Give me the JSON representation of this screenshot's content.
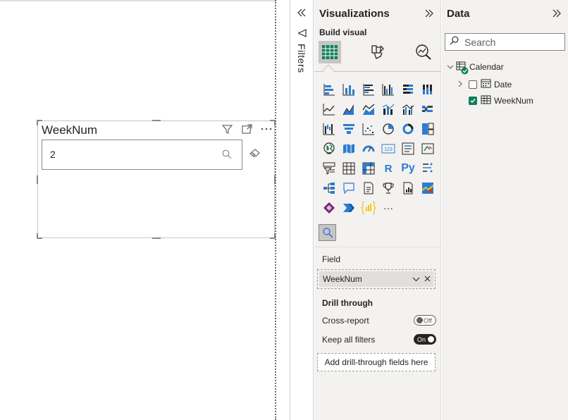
{
  "canvas": {
    "visual": {
      "title": "WeekNum",
      "search_value": "2",
      "header_icons": [
        "filter-icon",
        "focus-mode-icon",
        "more-options-icon"
      ]
    }
  },
  "filters_pane": {
    "label": "Filters"
  },
  "visualizations": {
    "title": "Visualizations",
    "build_label": "Build visual",
    "tabs": [
      "build-visual-tab",
      "format-visual-tab",
      "analytics-tab"
    ],
    "r_label": "R",
    "py_label": "Py",
    "more_label": "···",
    "field_section": "Field",
    "field_value": "WeekNum",
    "drill_title": "Drill through",
    "cross_report_label": "Cross-report",
    "cross_report_state": "Off",
    "keep_filters_label": "Keep all filters",
    "keep_filters_state": "On",
    "drill_placeholder": "Add drill-through fields here"
  },
  "data_pane": {
    "title": "Data",
    "search_placeholder": "Search",
    "tables": [
      {
        "name": "Calendar",
        "expanded": true,
        "fields": [
          {
            "name": "Date",
            "checked": false,
            "type": "date-hierarchy"
          },
          {
            "name": "WeekNum",
            "checked": true,
            "type": "column"
          }
        ]
      }
    ]
  },
  "colors": {
    "accent_green": "#127e5b",
    "viz_blue": "#2b7cd3",
    "pane_bg": "#f3f2f1"
  }
}
